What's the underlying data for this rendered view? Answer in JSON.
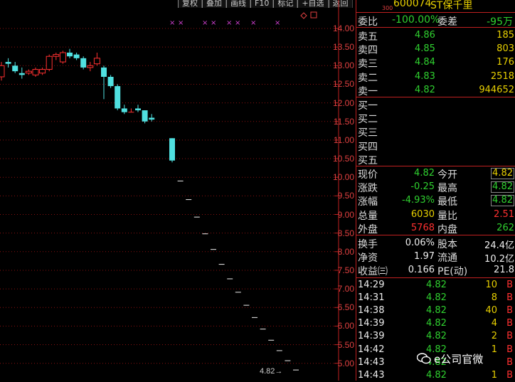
{
  "toolbar": {
    "buttons": [
      "复权",
      "叠加",
      "画线",
      "F10",
      "标记",
      "+自选",
      "返回"
    ]
  },
  "chart": {
    "y_ticks": [
      "14.00",
      "13.50",
      "13.00",
      "12.50",
      "12.00",
      "11.50",
      "11.00",
      "10.50",
      "10.00",
      "9.50",
      "9.00",
      "8.50",
      "8.00",
      "7.50",
      "7.00",
      "6.50",
      "6.00",
      "5.50",
      "5.00"
    ],
    "last_price_label": "4.82",
    "marker_glyph": "×"
  },
  "chart_data": {
    "type": "candlestick",
    "ylim": [
      4.8,
      14.3
    ],
    "candles": [
      {
        "o": 12.7,
        "h": 13.1,
        "l": 12.6,
        "c": 13.0
      },
      {
        "o": 13.1,
        "h": 13.2,
        "l": 12.95,
        "c": 13.05
      },
      {
        "o": 13.0,
        "h": 13.1,
        "l": 12.8,
        "c": 12.85
      },
      {
        "o": 12.8,
        "h": 12.95,
        "l": 12.65,
        "c": 12.75
      },
      {
        "o": 12.8,
        "h": 12.9,
        "l": 12.75,
        "c": 12.85
      },
      {
        "o": 12.75,
        "h": 12.95,
        "l": 12.7,
        "c": 12.9
      },
      {
        "o": 12.8,
        "h": 12.95,
        "l": 12.75,
        "c": 12.9
      },
      {
        "o": 12.9,
        "h": 13.3,
        "l": 12.85,
        "c": 13.25
      },
      {
        "o": 13.25,
        "h": 13.35,
        "l": 13.15,
        "c": 13.3
      },
      {
        "o": 13.1,
        "h": 13.4,
        "l": 13.05,
        "c": 13.35
      },
      {
        "o": 13.35,
        "h": 13.45,
        "l": 13.2,
        "c": 13.25
      },
      {
        "o": 13.3,
        "h": 13.35,
        "l": 13.15,
        "c": 13.2
      },
      {
        "o": 13.2,
        "h": 13.25,
        "l": 12.9,
        "c": 12.95
      },
      {
        "o": 12.95,
        "h": 13.1,
        "l": 12.85,
        "c": 13.0
      },
      {
        "o": 13.05,
        "h": 13.35,
        "l": 13.0,
        "c": 13.2
      },
      {
        "o": 12.95,
        "h": 13.0,
        "l": 12.1,
        "c": 12.7
      },
      {
        "o": 12.7,
        "h": 12.75,
        "l": 12.4,
        "c": 12.45
      },
      {
        "o": 12.45,
        "h": 12.5,
        "l": 11.8,
        "c": 11.85
      },
      {
        "o": 11.85,
        "h": 11.95,
        "l": 11.7,
        "c": 11.75
      },
      {
        "o": 11.75,
        "h": 11.85,
        "l": 11.75,
        "c": 11.75
      },
      {
        "o": 11.85,
        "h": 11.95,
        "l": 11.75,
        "c": 11.8
      },
      {
        "o": 11.8,
        "h": 11.8,
        "l": 11.45,
        "c": 11.5
      },
      {
        "o": 11.6,
        "h": 11.7,
        "l": 11.5,
        "c": 11.55
      },
      {
        "o": 11.05,
        "h": 11.05,
        "l": 10.4,
        "c": 10.45
      },
      {
        "o": 9.9,
        "h": 9.9,
        "l": 9.9,
        "c": 9.9
      },
      {
        "o": 9.4,
        "h": 9.4,
        "l": 9.4,
        "c": 9.4
      },
      {
        "o": 8.93,
        "h": 8.93,
        "l": 8.93,
        "c": 8.93
      },
      {
        "o": 8.48,
        "h": 8.48,
        "l": 8.48,
        "c": 8.48
      },
      {
        "o": 8.06,
        "h": 8.06,
        "l": 8.06,
        "c": 8.06
      },
      {
        "o": 7.66,
        "h": 7.66,
        "l": 7.66,
        "c": 7.66
      },
      {
        "o": 7.27,
        "h": 7.27,
        "l": 7.27,
        "c": 7.27
      },
      {
        "o": 6.91,
        "h": 6.91,
        "l": 6.91,
        "c": 6.91
      },
      {
        "o": 6.56,
        "h": 6.56,
        "l": 6.56,
        "c": 6.56
      },
      {
        "o": 6.23,
        "h": 6.23,
        "l": 6.23,
        "c": 6.23
      },
      {
        "o": 5.92,
        "h": 5.92,
        "l": 5.92,
        "c": 5.92
      },
      {
        "o": 5.62,
        "h": 5.62,
        "l": 5.62,
        "c": 5.62
      },
      {
        "o": 5.34,
        "h": 5.34,
        "l": 5.34,
        "c": 5.34
      },
      {
        "o": 5.07,
        "h": 5.07,
        "l": 5.07,
        "c": 5.07
      },
      {
        "o": 4.82,
        "h": 4.82,
        "l": 4.82,
        "c": 4.82
      }
    ],
    "marker_candle_indices": [
      23,
      24,
      25,
      26,
      27,
      28,
      29,
      30,
      31
    ]
  },
  "panel": {
    "header_code": "600074",
    "header_sub": "300",
    "header_name": "ST保千里",
    "weibi_label": "委比",
    "weibi_value": "-100.00%",
    "weicha_label": "委差",
    "weicha_value": "-95万",
    "sell": [
      {
        "label": "卖五",
        "price": "4.86",
        "vol": "185"
      },
      {
        "label": "卖四",
        "price": "4.85",
        "vol": "803"
      },
      {
        "label": "卖三",
        "price": "4.84",
        "vol": "176"
      },
      {
        "label": "卖二",
        "price": "4.83",
        "vol": "2518"
      },
      {
        "label": "卖一",
        "price": "4.82",
        "vol": "944652"
      }
    ],
    "buy": [
      {
        "label": "买一"
      },
      {
        "label": "买二"
      },
      {
        "label": "买三"
      },
      {
        "label": "买四"
      },
      {
        "label": "买五"
      }
    ],
    "quote": [
      {
        "l1": "现价",
        "v1": "4.82",
        "l2": "今开",
        "v2": "4.82"
      },
      {
        "l1": "涨跌",
        "v1": "-0.25",
        "l2": "最高",
        "v2": "4.82"
      },
      {
        "l1": "涨幅",
        "v1": "-4.93%",
        "l2": "最低",
        "v2": "4.82"
      },
      {
        "l1": "总量",
        "v1": "6030",
        "l2": "量比",
        "v2": "2.51"
      },
      {
        "l1": "外盘",
        "v1": "5768",
        "l2": "内盘",
        "v2": "262"
      }
    ],
    "stats": [
      {
        "l1": "换手",
        "v1": "0.06%",
        "l2": "股本",
        "v2": "24.4亿"
      },
      {
        "l1": "净资",
        "v1": "1.97",
        "l2": "流通",
        "v2": "10.2亿"
      },
      {
        "l1": "收益㈢",
        "v1": "0.166",
        "l2": "PE(动)",
        "v2": "21.8"
      }
    ],
    "ticks": [
      {
        "time": "14:29",
        "price": "4.82",
        "vol": "10",
        "side": "B"
      },
      {
        "time": "14:31",
        "price": "4.82",
        "vol": "8",
        "side": "B"
      },
      {
        "time": "14:38",
        "price": "4.82",
        "vol": "40",
        "side": "B"
      },
      {
        "time": "14:39",
        "price": "4.82",
        "vol": "4",
        "side": "B"
      },
      {
        "time": "14:39",
        "price": "4.82",
        "vol": "2",
        "side": "B"
      },
      {
        "time": "14:42",
        "price": "4.82",
        "vol": "1",
        "side": "B"
      },
      {
        "time": "14:43",
        "price": "4.82",
        "vol": "",
        "side": "B"
      },
      {
        "time": "14:43",
        "price": "4.82",
        "vol": "1",
        "side": "B"
      }
    ]
  },
  "watermark": {
    "text": "e公司官微"
  },
  "colors": {
    "up": "#ff3030",
    "down": "#50e0e0",
    "grid": "#8b1010",
    "marker": "#d040d0"
  }
}
